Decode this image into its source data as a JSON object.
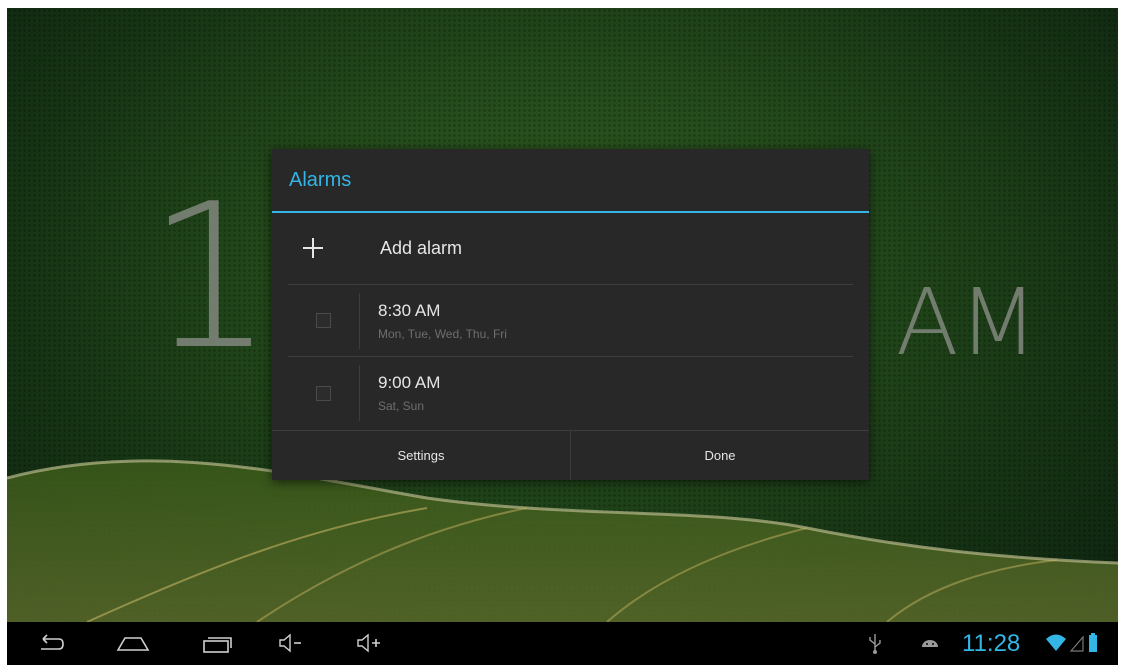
{
  "clock": {
    "hour": "1",
    "ampm": "AM"
  },
  "dialog": {
    "title": "Alarms",
    "add_label": "Add alarm",
    "alarms": [
      {
        "time": "8:30 AM",
        "days": "Mon, Tue, Wed, Thu, Fri",
        "enabled": false
      },
      {
        "time": "9:00 AM",
        "days": "Sat, Sun",
        "enabled": false
      }
    ],
    "settings_label": "Settings",
    "done_label": "Done"
  },
  "status_bar": {
    "time": "11:28"
  },
  "colors": {
    "accent": "#33b5e5",
    "dialog_bg": "#282828",
    "navbar_bg": "#000000"
  },
  "icons": [
    "back-icon",
    "home-icon",
    "recents-icon",
    "volume-down-icon",
    "volume-up-icon",
    "usb-icon",
    "android-debug-icon",
    "wifi-icon",
    "signal-icon",
    "battery-icon"
  ]
}
